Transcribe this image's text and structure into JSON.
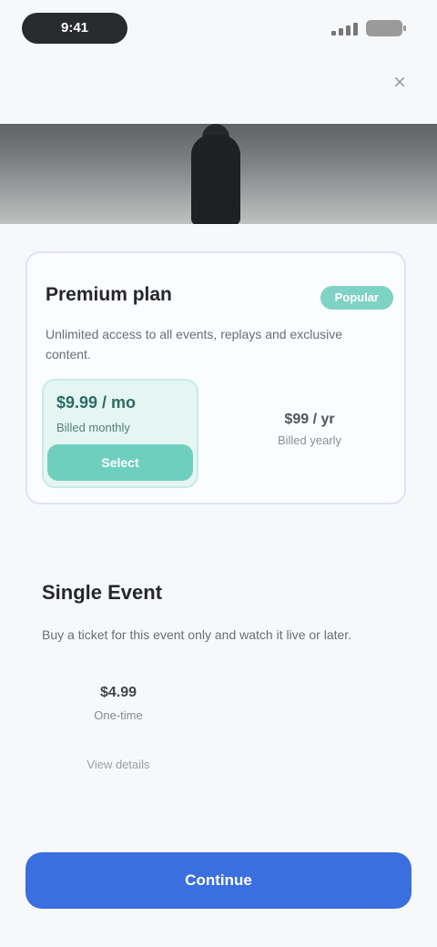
{
  "status_bar": {
    "time": "9:41"
  },
  "nav": {
    "close_label": "×"
  },
  "premium": {
    "title": "Premium plan",
    "badge": "Popular",
    "description": "Unlimited access to all events, replays and exclusive content.",
    "selected_plan": {
      "price": "$9.99 / mo",
      "period": "Billed monthly",
      "cta": "Select"
    },
    "other_plan": {
      "price": "$99 / yr",
      "period": "Billed yearly"
    }
  },
  "single_event": {
    "title": "Single Event",
    "description": "Buy a ticket for this event only and watch it live or later.",
    "price": "$4.99",
    "period": "One-time",
    "link": "View details"
  },
  "primary_action": {
    "label": "Continue"
  },
  "colors": {
    "accent": "#3b6fe0",
    "teal": "#6fcfbf",
    "card_border": "#dbe3fb"
  }
}
